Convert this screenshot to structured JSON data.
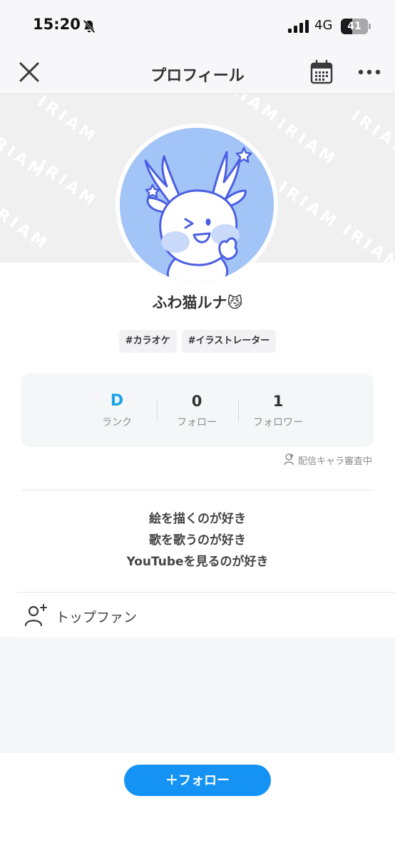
{
  "status_bar": {
    "time": "15:20",
    "network": "4G",
    "battery": "41"
  },
  "nav": {
    "title": "プロフィール",
    "icons": [
      "close-icon",
      "calendar-icon",
      "more-icon"
    ]
  },
  "banner": {
    "watermark": "IRIAM"
  },
  "profile": {
    "name": "ふわ猫ルナ😼",
    "tags": [
      "#カラオケ",
      "#イラストレーター"
    ]
  },
  "stats": {
    "rank": {
      "value": "D",
      "label": "ランク"
    },
    "follow": {
      "value": "0",
      "label": "フォロー"
    },
    "followers": {
      "value": "1",
      "label": "フォロワー"
    }
  },
  "review_note": "配信キャラ審査中",
  "bio": [
    "絵を描くのが好き",
    "歌を歌うのが好き",
    "YouTubeを見るのが好き"
  ],
  "top_fan": {
    "label": "トップファン"
  },
  "follow_button": {
    "label": "＋フォロー"
  },
  "colors": {
    "accent": "#1593f5",
    "rank": "#1aa4e8",
    "avatar_bg": "#a3c4f7"
  }
}
